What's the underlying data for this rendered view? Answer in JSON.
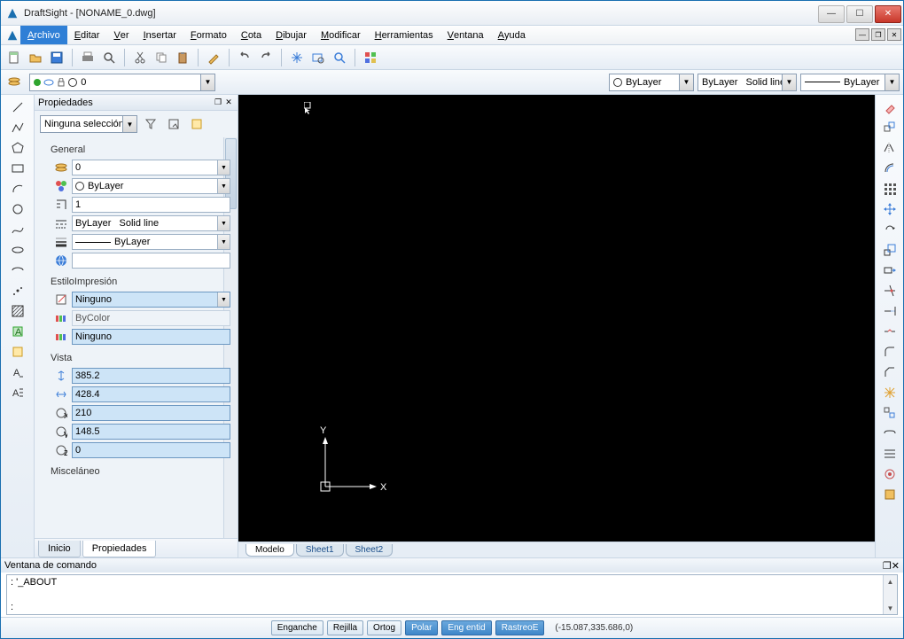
{
  "window": {
    "title": "DraftSight - [NONAME_0.dwg]"
  },
  "menu": {
    "items": [
      {
        "label": "Archivo",
        "ul": "A",
        "rest": "rchivo",
        "active": true
      },
      {
        "label": "Editar",
        "ul": "E",
        "rest": "ditar"
      },
      {
        "label": "Ver",
        "ul": "V",
        "rest": "er"
      },
      {
        "label": "Insertar",
        "ul": "I",
        "rest": "nsertar"
      },
      {
        "label": "Formato",
        "ul": "F",
        "rest": "ormato"
      },
      {
        "label": "Cota",
        "ul": "C",
        "rest": "ota"
      },
      {
        "label": "Dibujar",
        "ul": "D",
        "rest": "ibujar"
      },
      {
        "label": "Modificar",
        "ul": "M",
        "rest": "odificar"
      },
      {
        "label": "Herramientas",
        "ul": "H",
        "rest": "erramientas"
      },
      {
        "label": "Ventana",
        "ul": "V",
        "rest": "entana"
      },
      {
        "label": "Ayuda",
        "ul": "A",
        "rest": "yuda"
      }
    ]
  },
  "layerbar": {
    "layer_value": "0",
    "linecolor": "ByLayer",
    "lineweight": "ByLayer",
    "linestyle": "Solid line",
    "lineweight2": "ByLayer"
  },
  "properties": {
    "panel_title": "Propiedades",
    "selection": "Ninguna selección",
    "groups": {
      "general": {
        "title": "General",
        "layer": "0",
        "linecolor": "ByLayer",
        "scale": "1",
        "linestyle_left": "ByLayer",
        "linestyle_right": "Solid line",
        "lineweight": "ByLayer",
        "hyperlink": ""
      },
      "print": {
        "title": "EstiloImpresión",
        "style": "Ninguno",
        "bycolor": "ByColor",
        "table": "Ninguno"
      },
      "view": {
        "title": "Vista",
        "height": "385.2",
        "width": "428.4",
        "center_x": "210",
        "center_y": "148.5",
        "center_z": "0"
      },
      "misc": {
        "title": "Misceláneo"
      }
    },
    "tabs": {
      "inicio": "Inicio",
      "propiedades": "Propiedades"
    }
  },
  "model_tabs": {
    "model": "Modelo",
    "sheet1": "Sheet1",
    "sheet2": "Sheet2"
  },
  "command": {
    "title": "Ventana de comando",
    "line1": ": '_ABOUT",
    "prompt": ": "
  },
  "status": {
    "buttons": [
      {
        "label": "Enganche",
        "active": false
      },
      {
        "label": "Rejilla",
        "active": false
      },
      {
        "label": "Ortog",
        "active": false
      },
      {
        "label": "Polar",
        "active": true
      },
      {
        "label": "Eng entid",
        "active": true
      },
      {
        "label": "RastreoE",
        "active": true
      }
    ],
    "coords": "(-15.087,335.686,0)"
  },
  "ucs": {
    "x": "X",
    "y": "Y"
  }
}
